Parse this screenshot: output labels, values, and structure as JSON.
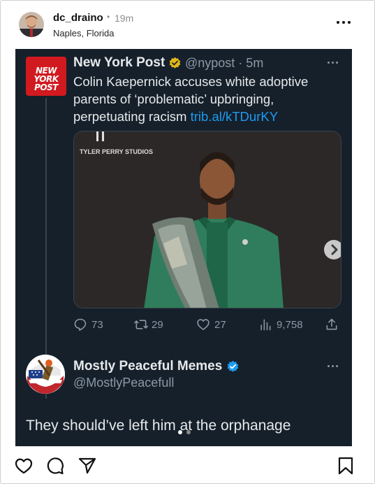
{
  "post": {
    "username": "dc_draino",
    "separator": "•",
    "time": "19m",
    "location": "Naples, Florida",
    "more_icon": "more-horizontal-icon"
  },
  "tweet": {
    "logo_lines": [
      "NEW",
      "YORK",
      "POST"
    ],
    "author_name": "New York Post",
    "badge": "gold-verified-badge",
    "handle": "@nypost · 5m",
    "text": "Colin Kaepernick accuses white adoptive parents of ‘problematic’ upbringing, perpetuating racism ",
    "link": "trib.al/kTDurKY",
    "media_studio_text": "TYLER PERRY STUDIOS",
    "actions": {
      "replies": "73",
      "retweets": "29",
      "likes": "27",
      "views": "9,758"
    }
  },
  "reply": {
    "author_name": "Mostly Peaceful Memes",
    "badge": "blue-verified-badge",
    "handle": "@MostlyPeacefull",
    "text": "They should’ve left him at the orphanage"
  },
  "carousel": {
    "count": 2,
    "active": 1
  },
  "colors": {
    "card_bg": "#15202b",
    "text_primary": "#e7e9ea",
    "text_secondary": "#8b98a5",
    "link": "#1d9bf0",
    "nyp_red": "#d11a20",
    "gold": "#e2b719",
    "blue": "#1d9bf0"
  }
}
